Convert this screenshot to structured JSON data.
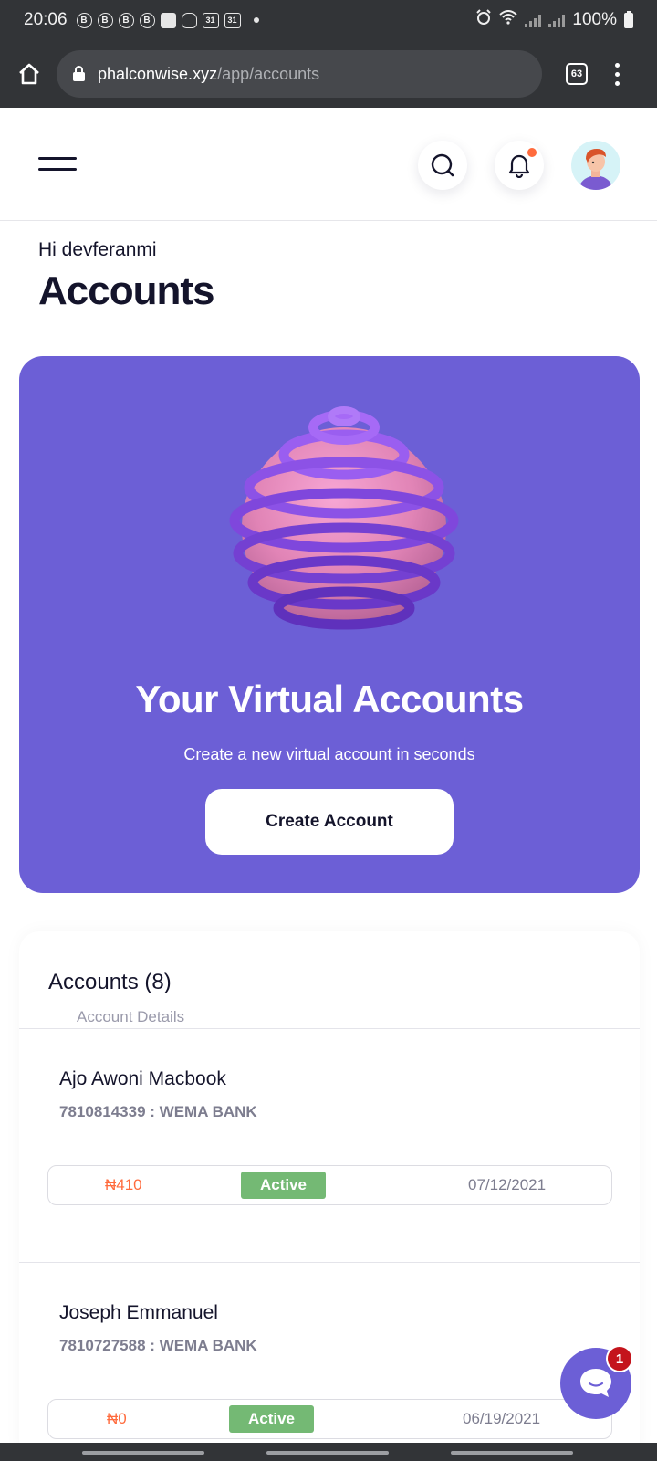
{
  "status_bar": {
    "time": "20:06",
    "notif_icons": [
      "B",
      "B",
      "B",
      "B",
      "msg",
      "snap",
      "31",
      "31"
    ],
    "battery": "100%"
  },
  "browser": {
    "domain": "phalconwise.xyz",
    "path": "/app/accounts",
    "tab_count": "63"
  },
  "header": {
    "icons": [
      "menu-icon",
      "search-icon",
      "bell-icon",
      "avatar"
    ]
  },
  "greeting": "Hi devferanmi",
  "page_title": "Accounts",
  "hero": {
    "title": "Your Virtual Accounts",
    "subtitle": "Create a new virtual account in seconds",
    "button_label": "Create Account",
    "bg_color": "#6c5fd6"
  },
  "accounts": {
    "heading": "Accounts (8)",
    "subheading": "Account Details",
    "items": [
      {
        "name": "Ajo Awoni Macbook",
        "meta": "7810814339 : WEMA BANK",
        "amount": "₦410",
        "status": "Active",
        "date": "07/12/2021"
      },
      {
        "name": "Joseph Emmanuel",
        "meta": "7810727588 : WEMA BANK",
        "amount": "₦0",
        "status": "Active",
        "date": "06/19/2021"
      }
    ]
  },
  "chat": {
    "badge": "1"
  },
  "colors": {
    "accent": "#6c5fd6",
    "amount": "#ff6b3d",
    "status_active": "#74b974",
    "notif": "#ff6b3d",
    "chat_badge": "#c4141c"
  }
}
